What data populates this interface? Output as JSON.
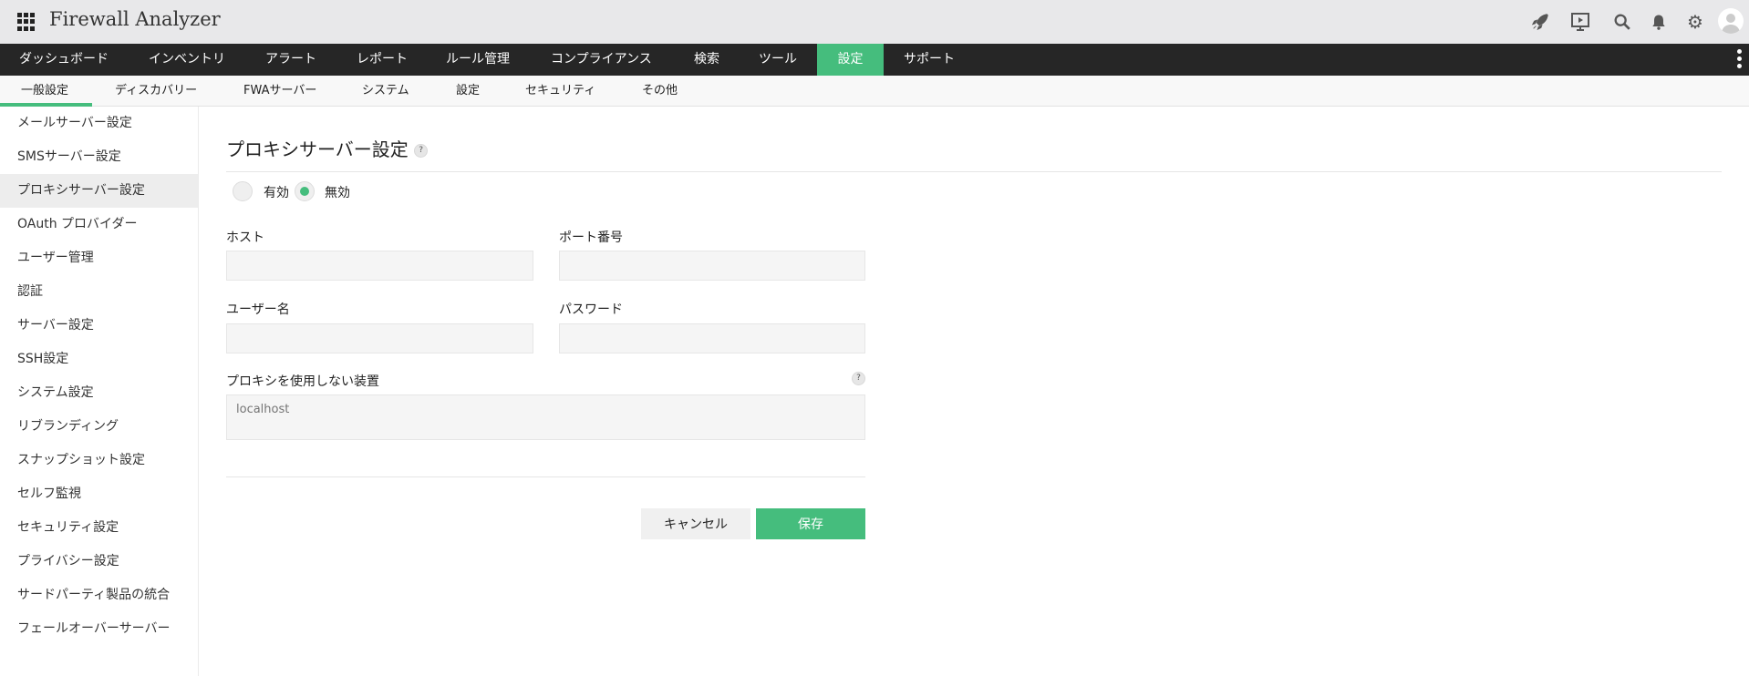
{
  "app": {
    "title": "Firewall Analyzer"
  },
  "top_icons": [
    "rocket-icon",
    "presentation-icon",
    "search-icon",
    "bell-icon",
    "gear-icon",
    "user-avatar-icon"
  ],
  "nav": {
    "items": [
      "ダッシュボード",
      "インベントリ",
      "アラート",
      "レポート",
      "ルール管理",
      "コンプライアンス",
      "検索",
      "ツール",
      "設定",
      "サポート"
    ],
    "active": "設定"
  },
  "subnav": {
    "items": [
      "一般設定",
      "ディスカバリー",
      "FWAサーバー",
      "システム",
      "設定",
      "セキュリティ",
      "その他"
    ],
    "active": "一般設定"
  },
  "sidebar": {
    "items": [
      "メールサーバー設定",
      "SMSサーバー設定",
      "プロキシサーバー設定",
      "OAuth プロバイダー",
      "ユーザー管理",
      "認証",
      "サーバー設定",
      "SSH設定",
      "システム設定",
      "リブランディング",
      "スナップショット設定",
      "セルフ監視",
      "セキュリティ設定",
      "プライバシー設定",
      "サードパーティ製品の統合",
      "フェールオーバーサーバー"
    ],
    "selected": "プロキシサーバー設定"
  },
  "form": {
    "title": "プロキシサーバー設定",
    "help": "?",
    "radio_enable": "有効",
    "radio_disable": "無効",
    "selected": "無効",
    "host_label": "ホスト",
    "host_value": "",
    "port_label": "ポート番号",
    "port_value": "",
    "user_label": "ユーザー名",
    "user_value": "",
    "password_label": "パスワード",
    "password_value": "",
    "bypass_label": "プロキシを使用しない装置",
    "bypass_placeholder": "localhost",
    "cancel": "キャンセル",
    "save": "保存"
  },
  "colors": {
    "accent": "#45bd7d",
    "nav_bg": "#262626"
  }
}
